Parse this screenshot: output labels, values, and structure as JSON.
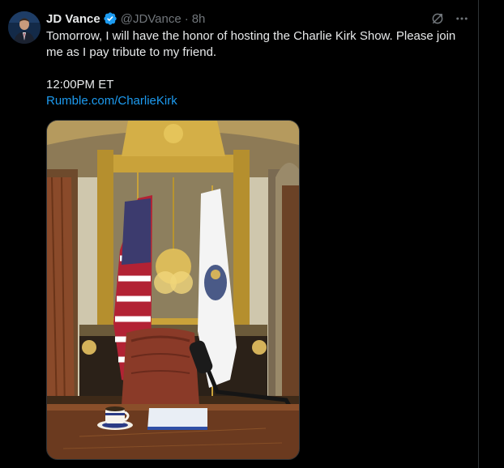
{
  "tweet": {
    "author_name": "JD Vance",
    "handle": "@JDVance",
    "separator": "·",
    "timestamp": "8h",
    "text_line_1": "Tomorrow, I will have the honor of hosting the Charlie Kirk Show. Please join",
    "text_line_2": "me as I pay tribute to my friend.",
    "time_line": "12:00PM ET",
    "link_text": "Rumble.com/CharlieKirk",
    "verified_icon": "verified-badge-icon",
    "actions": [
      "grok-icon",
      "more-icon"
    ],
    "media": {
      "icon": "photo-office-with-flags-and-desk",
      "colors": {
        "gold": "#c9a23a",
        "wood": "#6b3a1f",
        "leather": "#8a3a28",
        "wall": "#c8c0a8"
      }
    }
  },
  "colors": {
    "background": "#000000",
    "text": "#e7e9ea",
    "muted": "#71767b",
    "link": "#1d9bf0",
    "verified": "#1d9bf0",
    "divider": "#2f3336"
  }
}
